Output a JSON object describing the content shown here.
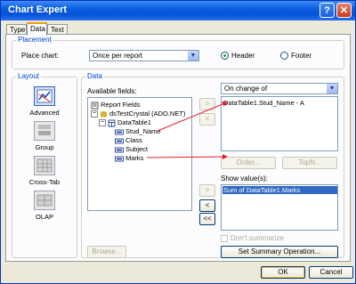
{
  "window": {
    "title": "Chart Expert",
    "help_label": "?",
    "close_label": "✕"
  },
  "tabs": [
    {
      "label": "Type"
    },
    {
      "label": "Data"
    },
    {
      "label": "Text"
    }
  ],
  "placement": {
    "group_label": "Placement",
    "place_chart_label": "Place chart:",
    "place_chart_value": "Once per report",
    "header_label": "Header",
    "footer_label": "Footer",
    "selected": "Header"
  },
  "layout": {
    "group_label": "Layout",
    "options": [
      {
        "label": "Advanced"
      },
      {
        "label": "Group"
      },
      {
        "label": "Cross-Tab"
      },
      {
        "label": "OLAP"
      }
    ],
    "selected": "Advanced"
  },
  "data": {
    "group_label": "Data",
    "available_label": "Available fields:",
    "tree": {
      "root": "Report Fields",
      "source": "dsTestCrystal (ADO.NET)",
      "table": "DataTable1",
      "fields": [
        "Stud_Name",
        "Class",
        "Subject",
        "Marks"
      ]
    },
    "browse_label": "Browse...",
    "on_change_value": "On change of",
    "on_change_items": [
      "DataTable1.Stud_Name - A"
    ],
    "order_label": "Order...",
    "topn_label": "TopN...",
    "show_values_label": "Show value(s):",
    "show_values_items": [
      "Sum of DataTable1.Marks"
    ],
    "dont_summarize_label": "Don't summarize",
    "set_summary_label": "Set Summary Operation...",
    "move_buttons": {
      "right": ">",
      "left": "<",
      "all_left": "<<"
    }
  },
  "footer": {
    "ok_label": "OK",
    "cancel_label": "Cancel"
  },
  "colors": {
    "annotation_arrow": "#e0202a",
    "selection": "#316ac5",
    "title_bar": "#0a5ce0"
  }
}
